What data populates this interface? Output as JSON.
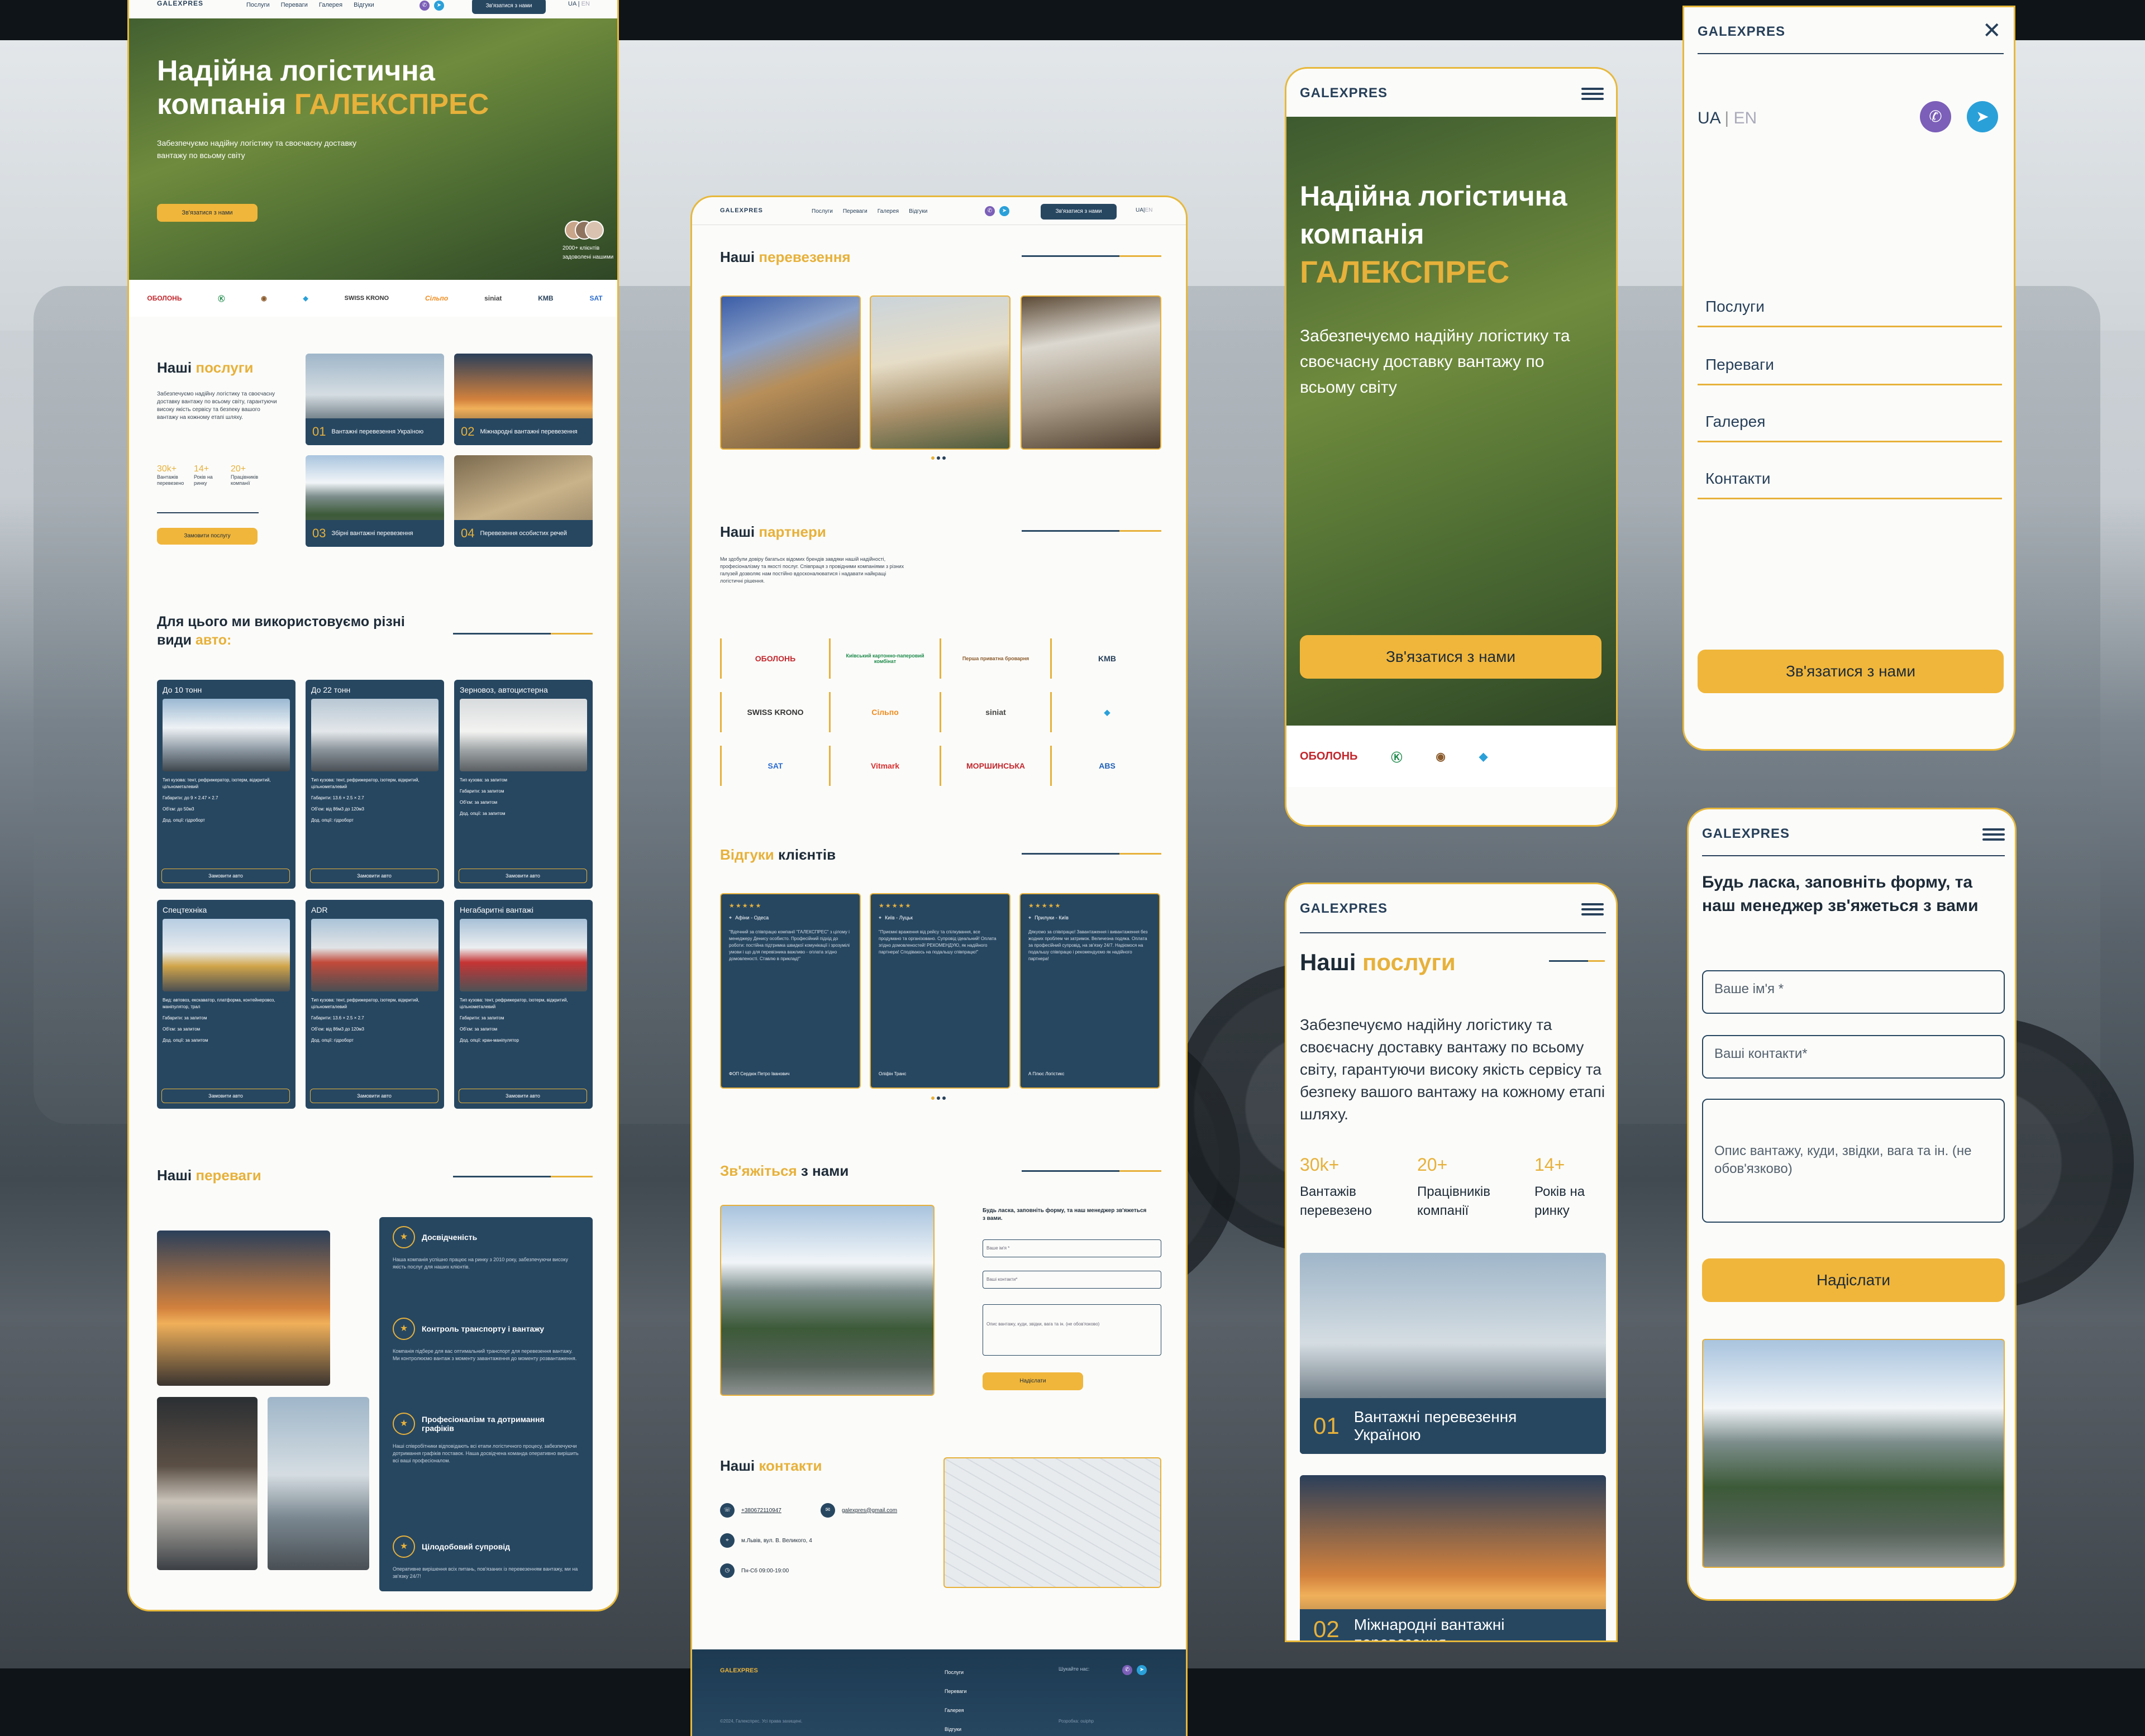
{
  "brand": "GALEXPRES",
  "nav": [
    "Послуги",
    "Переваги",
    "Галерея",
    "Відгуки"
  ],
  "lang": {
    "ua": "UA",
    "en": "EN"
  },
  "contact_btn": "Зв'язатися з нами",
  "hero": {
    "title_l1": "Надійна логістична",
    "title_l2": "компанія ",
    "title_accent": "ГАЛЕКСПРЕС",
    "sub": "Забезпечуємо надійну логістику та своєчасну доставку вантажу по всьому світу",
    "clients": "2000+ клієнтів",
    "clients_note": "задоволені нашими"
  },
  "partners_strip": [
    "ОБОЛОНЬ",
    "Київський картонно-паперовий комбінат",
    "Перша приватна броварня",
    "",
    "SWISS KRONO",
    "Сільпо",
    "siniat",
    "KMB",
    "SAT"
  ],
  "services": {
    "h_plain": "Наші ",
    "h_accent": "послуги",
    "desc": "Забезпечуємо надійну логістику та своєчасну доставку вантажу по всьому світу, гарантуючи високу якість сервісу та безпеку вашого вантажу на кожному етапі шляху.",
    "stats": [
      {
        "n": "30k+",
        "l": "Вантажів перевезено"
      },
      {
        "n": "14+",
        "l": "Років на ринку"
      },
      {
        "n": "20+",
        "l": "Працівників компанії"
      }
    ],
    "btn": "Замовити послугу",
    "items": [
      {
        "n": "01",
        "t": "Вантажні перевезення Україною"
      },
      {
        "n": "02",
        "t": "Міжнародні вантажні перевезення"
      },
      {
        "n": "03",
        "t": "Збірні вантажні перевезення"
      },
      {
        "n": "04",
        "t": "Перевезення особистих речей"
      }
    ]
  },
  "fleet": {
    "h": "Для цього ми використовуємо різні види ",
    "h_accent": "авто:",
    "btn": "Замовити авто",
    "cards": [
      {
        "t": "До 10 тонн",
        "specs": [
          "Тип кузова: тент, рефрижератор, ізотерм, відкритий, цільнометалевий",
          "Габарити: до 9 × 2.47 × 2.7",
          "Об'єм: до 50м3",
          "Дод. опції: гідроборт"
        ]
      },
      {
        "t": "До 22 тонн",
        "specs": [
          "Тип кузова: тент, рефрижератор, ізотерм, відкритий, цільнометалевий",
          "Габарити: 13.6 × 2.5 × 2.7",
          "Об'єм: від 86м3 до 120м3",
          "Дод. опції: гідроборт"
        ]
      },
      {
        "t": "Зерновоз, автоцистерна",
        "specs": [
          "Тип кузова: за запитом",
          "Габарити: за запитом",
          "Об'єм: за запитом",
          "Дод. опції: за запитом"
        ]
      },
      {
        "t": "Спецтехніка",
        "specs": [
          "Вид: автовоз, екскаватор, платформа, контейнеровоз, маніпулятор, трал",
          "Габарити: за запитом",
          "Об'єм: за запитом",
          "Дод. опції: за запитом"
        ]
      },
      {
        "t": "ADR",
        "specs": [
          "Тип кузова: тент, рефрижератор, ізотерм, відкритий, цільнометалевий",
          "Габарити: 13.6 × 2.5 × 2.7",
          "Об'єм: від 86м3 до 120м3",
          "Дод. опції: гідроборт"
        ]
      },
      {
        "t": "Негабаритні вантажі",
        "specs": [
          "Тип кузова: тент, рефрижератор, ізотерм, відкритий, цільнометалевий",
          "Габарити: за запитом",
          "Об'єм: за запитом",
          "Дод. опції: кран-маніпулятор"
        ]
      }
    ]
  },
  "advantages": {
    "h_plain": "Наші ",
    "h_accent": "переваги",
    "items": [
      {
        "t": "Досвідченість",
        "d": "Наша компанія успішно працює на ринку з 2010 року, забезпечуючи високу якість послуг для наших клієнтів."
      },
      {
        "t": "Контроль транспорту і вантажу",
        "d": "Компанія підбере для вас оптимальний транспорт для перевезення вантажу. Ми контролюємо вантаж з моменту завантаження до моменту розвантаження."
      },
      {
        "t": "Професіоналізм та дотримання графіків",
        "d": "Наші співробітники відповідають всі етапи логістичного процесу, забезпечуючи дотримання графіків поставок. Наша досвідчена команда оперативно вирішить всі ваші професіоналом."
      },
      {
        "t": "Цілодобовий супровід",
        "d": "Оперативне вирішення всіх питань, пов'язаних із перевезенням вантажу, ми на зв'язку 24/7!"
      }
    ]
  },
  "transport": {
    "h_plain": "Наші ",
    "h_accent": "перевезення"
  },
  "partners": {
    "h_plain": "Наші ",
    "h_accent": "партнери",
    "desc": "Ми здобули довіру багатьох відомих брендів завдяки нашій надійності, професіоналізму та якості послуг. Співпраця з провідними компаніями з різних галузей дозволяє нам постійно вдосконалюватися і надавати найкращі логістичні рішення.",
    "logos": [
      "ОБОЛОНЬ",
      "Київський картонно-паперовий комбінат",
      "Перша приватна броварня",
      "KMB",
      "SWISS KRONO",
      "Сільпо",
      "siniat",
      "",
      "SAT",
      "Vitmark",
      "МОРШИНСЬКА",
      "ABS"
    ]
  },
  "reviews": {
    "h_accent": "Відгуки",
    "h_plain": " клієнтів",
    "items": [
      {
        "loc": "Афіни - Одеса",
        "text": "\"Вдячний за співпрацю компанії \"ГАЛЕКСПРЕС\" з цілому і менеджеру Денису особисто. Професійний підхід до роботи: постійна підтримка швидкої комунікації і зрозумілі умови і що для перевізника важливо - оплата згідно домовленості. Ставлю в приклад!\"",
        "who": "ФОП Сердюк Петро Іванович"
      },
      {
        "loc": "Київ - Луцьк",
        "text": "\"Приємні враження від рейсу та спілкування, все продумано та організовано. Супровід ідеальний! Оплата згідно домовленостей! РЕКОМЕНДУЮ, як надійного партнера! Сподіваюсь на подальшу співпрацю!\"",
        "who": "Оліфін Транс"
      },
      {
        "loc": "Прилуки - Київ",
        "text": "Дякуємо за співпрацю! Завантаження і вивантаження без жодних проблем чи затримок. Величезна подяка. Оплата за професійний супровід, на зв'язку 24/7. Надіємося на подальшу співпрацю і рекомендуємо як надійного партнера!",
        "who": "А Плюс Логістикс"
      }
    ]
  },
  "contact_form": {
    "h_accent": "Зв'яжіться",
    "h_plain": " з нами",
    "lead": "Будь ласка, заповніть форму, та наш менеджер зв'яжеться з вами.",
    "name_ph": "Ваше ім'я *",
    "contact_ph": "Ваші контакти*",
    "msg_ph": "Опис вантажу, куди, звідки, вага та ін. (не обов'язково)",
    "submit": "Надіслати"
  },
  "contacts": {
    "h_plain": "Наші ",
    "h_accent": "контакти",
    "phone": "+380672110947",
    "email": "galexpres@gmail.com",
    "address": "м.Львів, вул. В. Великого, 4",
    "hours": "Пн-Сб 09:00-19:00"
  },
  "footer": {
    "brand": "GALEXPRES",
    "links": [
      "Послуги",
      "Переваги",
      "Галерея",
      "Відгуки"
    ],
    "social": "Шукайте нас:",
    "copy": "©2024, Галекспрес. Усі права захищені.",
    "dev": "Розробка: ouiphp"
  },
  "mobile_hero": {
    "t1": "Надійна логістична",
    "t2": "компанія",
    "t3": "ГАЛЕКСПРЕС",
    "sub": "Забезпечуємо надійну логістику та своєчасну доставку вантажу по всьому світу"
  },
  "mobile_menu": [
    "Послуги",
    "Переваги",
    "Галерея",
    "Контакти"
  ],
  "mobile_form": {
    "lead": "Будь ласка, заповніть форму, та наш менеджер зв'яжеться з вами"
  }
}
